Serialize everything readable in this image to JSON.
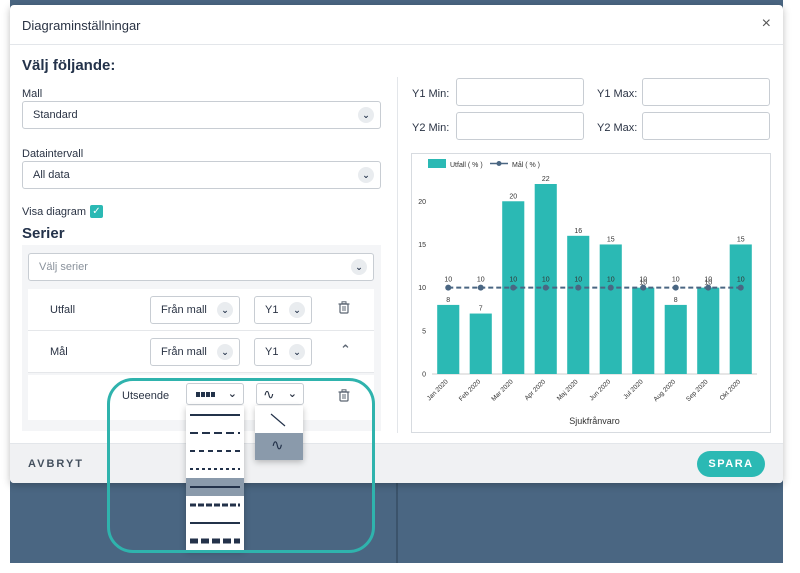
{
  "dialog": {
    "title": "Diagraminställningar",
    "close": "×"
  },
  "left": {
    "heading": "Välj följande:",
    "mall_label": "Mall",
    "mall_value": "Standard",
    "interval_label": "Dataintervall",
    "interval_value": "All data",
    "show_chart_label": "Visa diagram",
    "show_chart_checked": true,
    "series_heading": "Serier",
    "series_placeholder": "Välj serier",
    "rows": [
      {
        "name": "Utfall",
        "source": "Från mall",
        "axis": "Y1"
      },
      {
        "name": "Mål",
        "source": "Från mall",
        "axis": "Y1"
      }
    ],
    "appearance_label": "Utseende",
    "line_style_options": [
      "solid",
      "dash-long",
      "dash-medium",
      "dash-short",
      "solid",
      "dash-dense",
      "solid",
      "dash-blocks"
    ],
    "line_style_selected_index": 4,
    "curve_options": [
      "straight",
      "smooth"
    ],
    "curve_selected_index": 1
  },
  "right": {
    "y1min_label": "Y1 Min:",
    "y1max_label": "Y1 Max:",
    "y2min_label": "Y2 Min:",
    "y2max_label": "Y2 Max:"
  },
  "chart_data": {
    "type": "bar",
    "categories": [
      "Jan 2020",
      "Feb 2020",
      "Mar 2020",
      "Apr 2020",
      "Maj 2020",
      "Jun 2020",
      "Jul 2020",
      "Aug 2020",
      "Sep 2020",
      "Okt 2020"
    ],
    "series": [
      {
        "name": "Utfall ( % )",
        "type": "bar",
        "values": [
          8,
          7,
          20,
          22,
          16,
          15,
          10,
          8,
          10,
          15
        ],
        "color": "#2bb9b4"
      },
      {
        "name": "Mål ( % )",
        "type": "line",
        "values": [
          10,
          10,
          10,
          10,
          10,
          10,
          10,
          10,
          10,
          10
        ],
        "color": "#4a6682",
        "dashed": true
      }
    ],
    "xlabel": "Sjukfrånvaro",
    "ylim": [
      0,
      22
    ],
    "yticks": [
      0,
      5,
      10,
      15,
      20
    ],
    "legend": "top-left"
  },
  "footer": {
    "cancel": "AVBRYT",
    "save": "SPARA"
  },
  "colors": {
    "accent": "#2bb9b4",
    "backdrop": "#4a6682",
    "dark": "#23324a"
  },
  "icons": {
    "chevron": "chevron-down-icon",
    "trash": "trash-icon",
    "check": "check-icon"
  }
}
